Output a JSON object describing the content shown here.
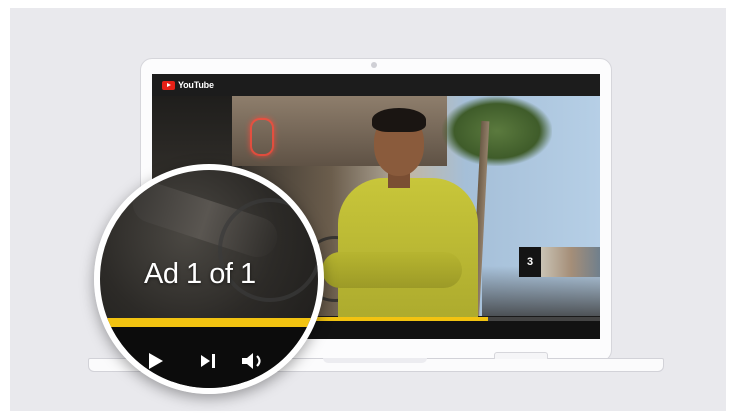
{
  "player": {
    "brand": "YouTube",
    "ad_label": "Ad 1 of 1",
    "next_thumbnail_count": "3",
    "progress_fraction": 0.75,
    "accent_color": "#f2c311",
    "brand_color": "#e62117"
  },
  "icons": {
    "play": "play-icon",
    "skip_next": "skip-next-icon",
    "volume": "volume-icon",
    "logo": "youtube-logo-icon"
  }
}
